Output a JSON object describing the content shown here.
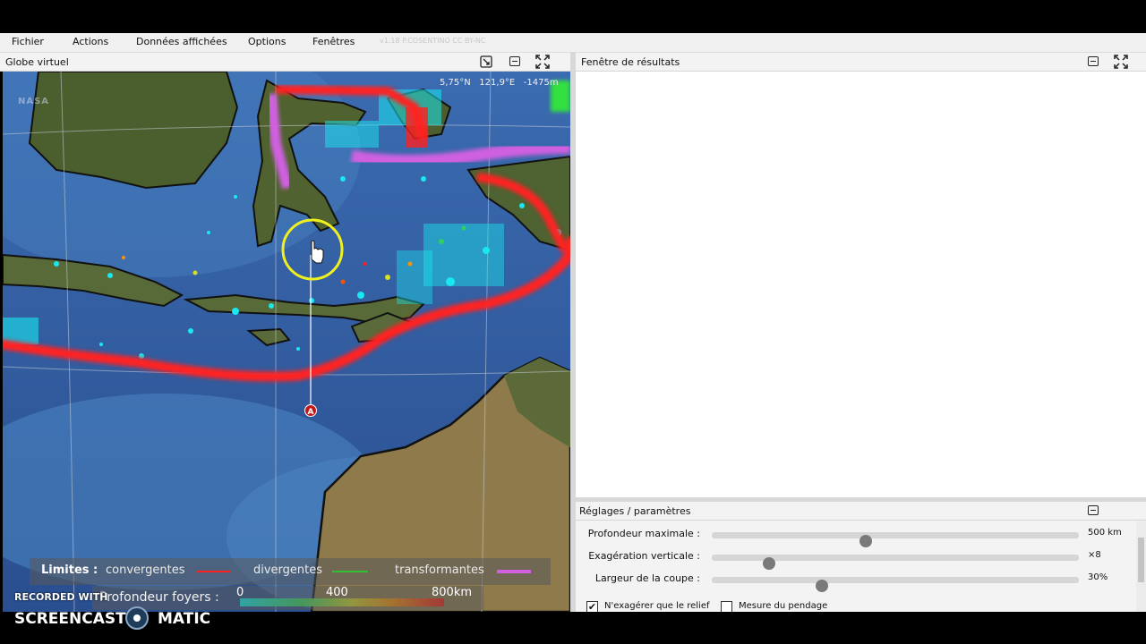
{
  "menu": {
    "items": [
      "Fichier",
      "Actions",
      "Données affichées",
      "Options",
      "Fenêtres"
    ],
    "version": "v1.18 P.COSENTINO CC BY-NC"
  },
  "globe_panel": {
    "title": "Globe virtuel",
    "coords": {
      "lat": "5,75°N",
      "lon": "121,9°E",
      "alt": "-1475m"
    },
    "watermark": "NASA",
    "marker": "A",
    "legend": {
      "limits_label": "Limites :",
      "convergent": "convergentes",
      "divergent": "divergentes",
      "transform": "transformantes",
      "depth_label": "Profondeur foyers :",
      "depth_ticks": [
        "0",
        "400",
        "800km"
      ],
      "colors": {
        "convergent": "#ff2020",
        "divergent": "#30c030",
        "transform": "#d060e0"
      }
    }
  },
  "results_panel": {
    "title": "Fenêtre de résultats"
  },
  "settings_panel": {
    "title": "Réglages / paramètres",
    "sliders": [
      {
        "label": "Profondeur maximale :",
        "value": "500 km",
        "fraction": 0.42
      },
      {
        "label": "Exagération verticale :",
        "value": "×8",
        "fraction": 0.155
      },
      {
        "label": "Largeur de la coupe :",
        "value": "30%",
        "fraction": 0.3
      }
    ],
    "checkboxes": [
      {
        "label": "N'exagérer que le relief",
        "checked": true
      },
      {
        "label": "Mesure du pendage",
        "checked": false
      }
    ]
  },
  "recorder": {
    "recorded_with": "RECORDED WITH",
    "brand_left": "SCREENCAST",
    "brand_right": "MATIC"
  }
}
